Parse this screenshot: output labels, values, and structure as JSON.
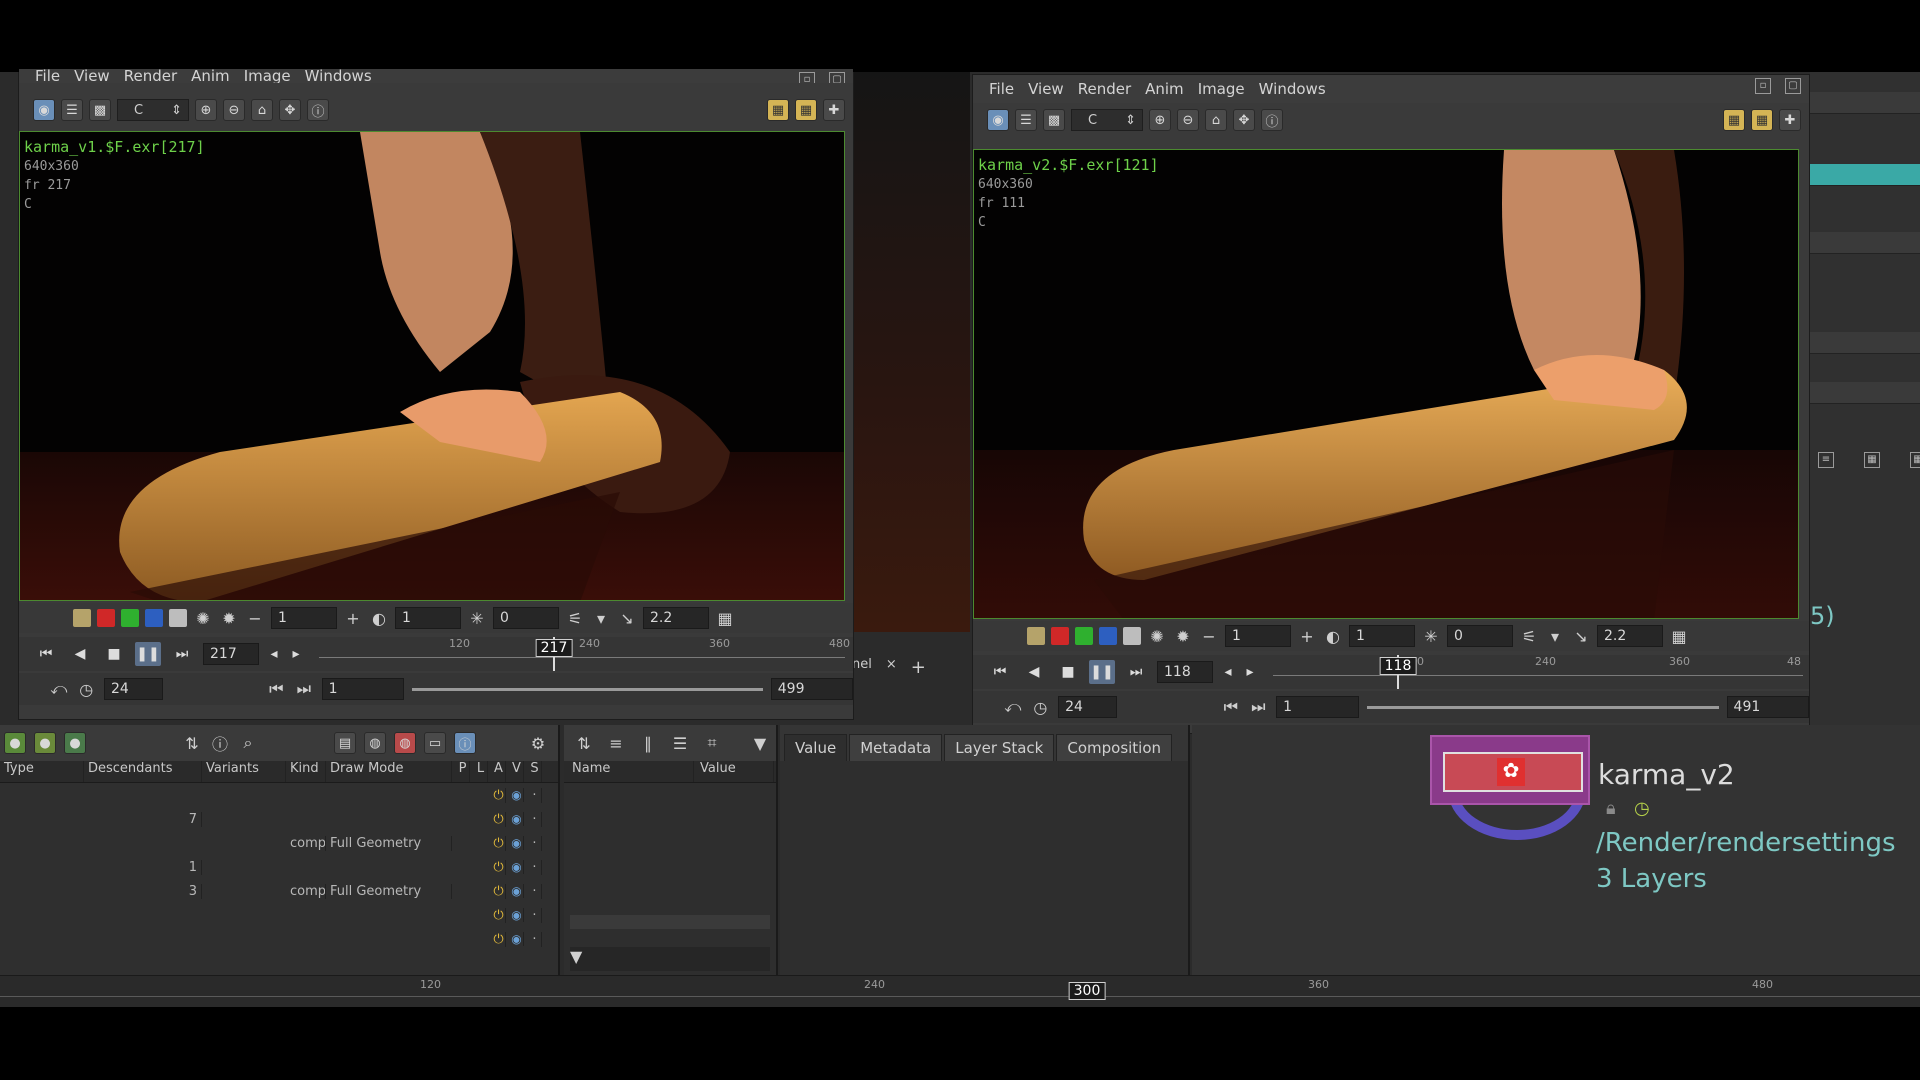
{
  "viewer1": {
    "menu": [
      "File",
      "View",
      "Render",
      "Anim",
      "Image",
      "Windows"
    ],
    "channel": "C",
    "overlay": {
      "filename": "karma_v1.$F.exr[217]",
      "resolution": "640x360",
      "frame": "fr 217",
      "channel": "C"
    },
    "controls": {
      "exposure": "1",
      "gamma_field": "1",
      "offset": "0",
      "gamma": "2.2"
    },
    "playbar": {
      "frame": "217",
      "ticks": [
        "120",
        "240",
        "360",
        "480"
      ],
      "cursor_label": "217"
    },
    "range": {
      "fps": "24",
      "start": "1",
      "end": "499"
    }
  },
  "viewer2": {
    "menu": [
      "File",
      "View",
      "Render",
      "Anim",
      "Image",
      "Windows"
    ],
    "channel": "C",
    "overlay": {
      "filename": "karma_v2.$F.exr[121]",
      "resolution": "640x360",
      "frame": "fr 111",
      "channel": "C"
    },
    "controls": {
      "exposure": "1",
      "gamma_field": "1",
      "offset": "0",
      "gamma": "2.2"
    },
    "playbar": {
      "frame": "118",
      "ticks": [
        "120",
        "240",
        "360",
        "48"
      ],
      "cursor_label": "118"
    },
    "range": {
      "fps": "24",
      "start": "1",
      "end": "491"
    }
  },
  "scene_graph": {
    "columns": [
      "Type",
      "Descendants",
      "Variants",
      "Kind",
      "Draw Mode",
      "P",
      "L",
      "A",
      "V",
      "S"
    ],
    "rows": [
      {
        "descendants": "",
        "kind": "",
        "draw_mode": ""
      },
      {
        "descendants": "7",
        "kind": "",
        "draw_mode": ""
      },
      {
        "descendants": "",
        "kind": "comp",
        "draw_mode": "Full Geometry"
      },
      {
        "descendants": "1",
        "kind": "",
        "draw_mode": ""
      },
      {
        "descendants": "3",
        "kind": "comp",
        "draw_mode": "Full Geometry"
      },
      {
        "descendants": "",
        "kind": "",
        "draw_mode": ""
      },
      {
        "descendants": "",
        "kind": "",
        "draw_mode": ""
      }
    ]
  },
  "details": {
    "columns": [
      "Name",
      "Value"
    ]
  },
  "props": {
    "tabs": [
      "Value",
      "Metadata",
      "Layer Stack",
      "Composition"
    ]
  },
  "panel_tab": {
    "label": "nel",
    "plus": "+"
  },
  "node": {
    "name": "karma_v2",
    "path": "/Render/rendersettings",
    "layers": "3 Layers",
    "partial": "5)"
  },
  "global_timeline": {
    "ticks": [
      "120",
      "240",
      "360",
      "480"
    ],
    "cursor": "300"
  },
  "colors": {
    "accent_green": "#6ed14a",
    "node_purple": "#8a3a8a",
    "teal": "#3aa9a6",
    "text_teal": "#7ec8c4"
  }
}
